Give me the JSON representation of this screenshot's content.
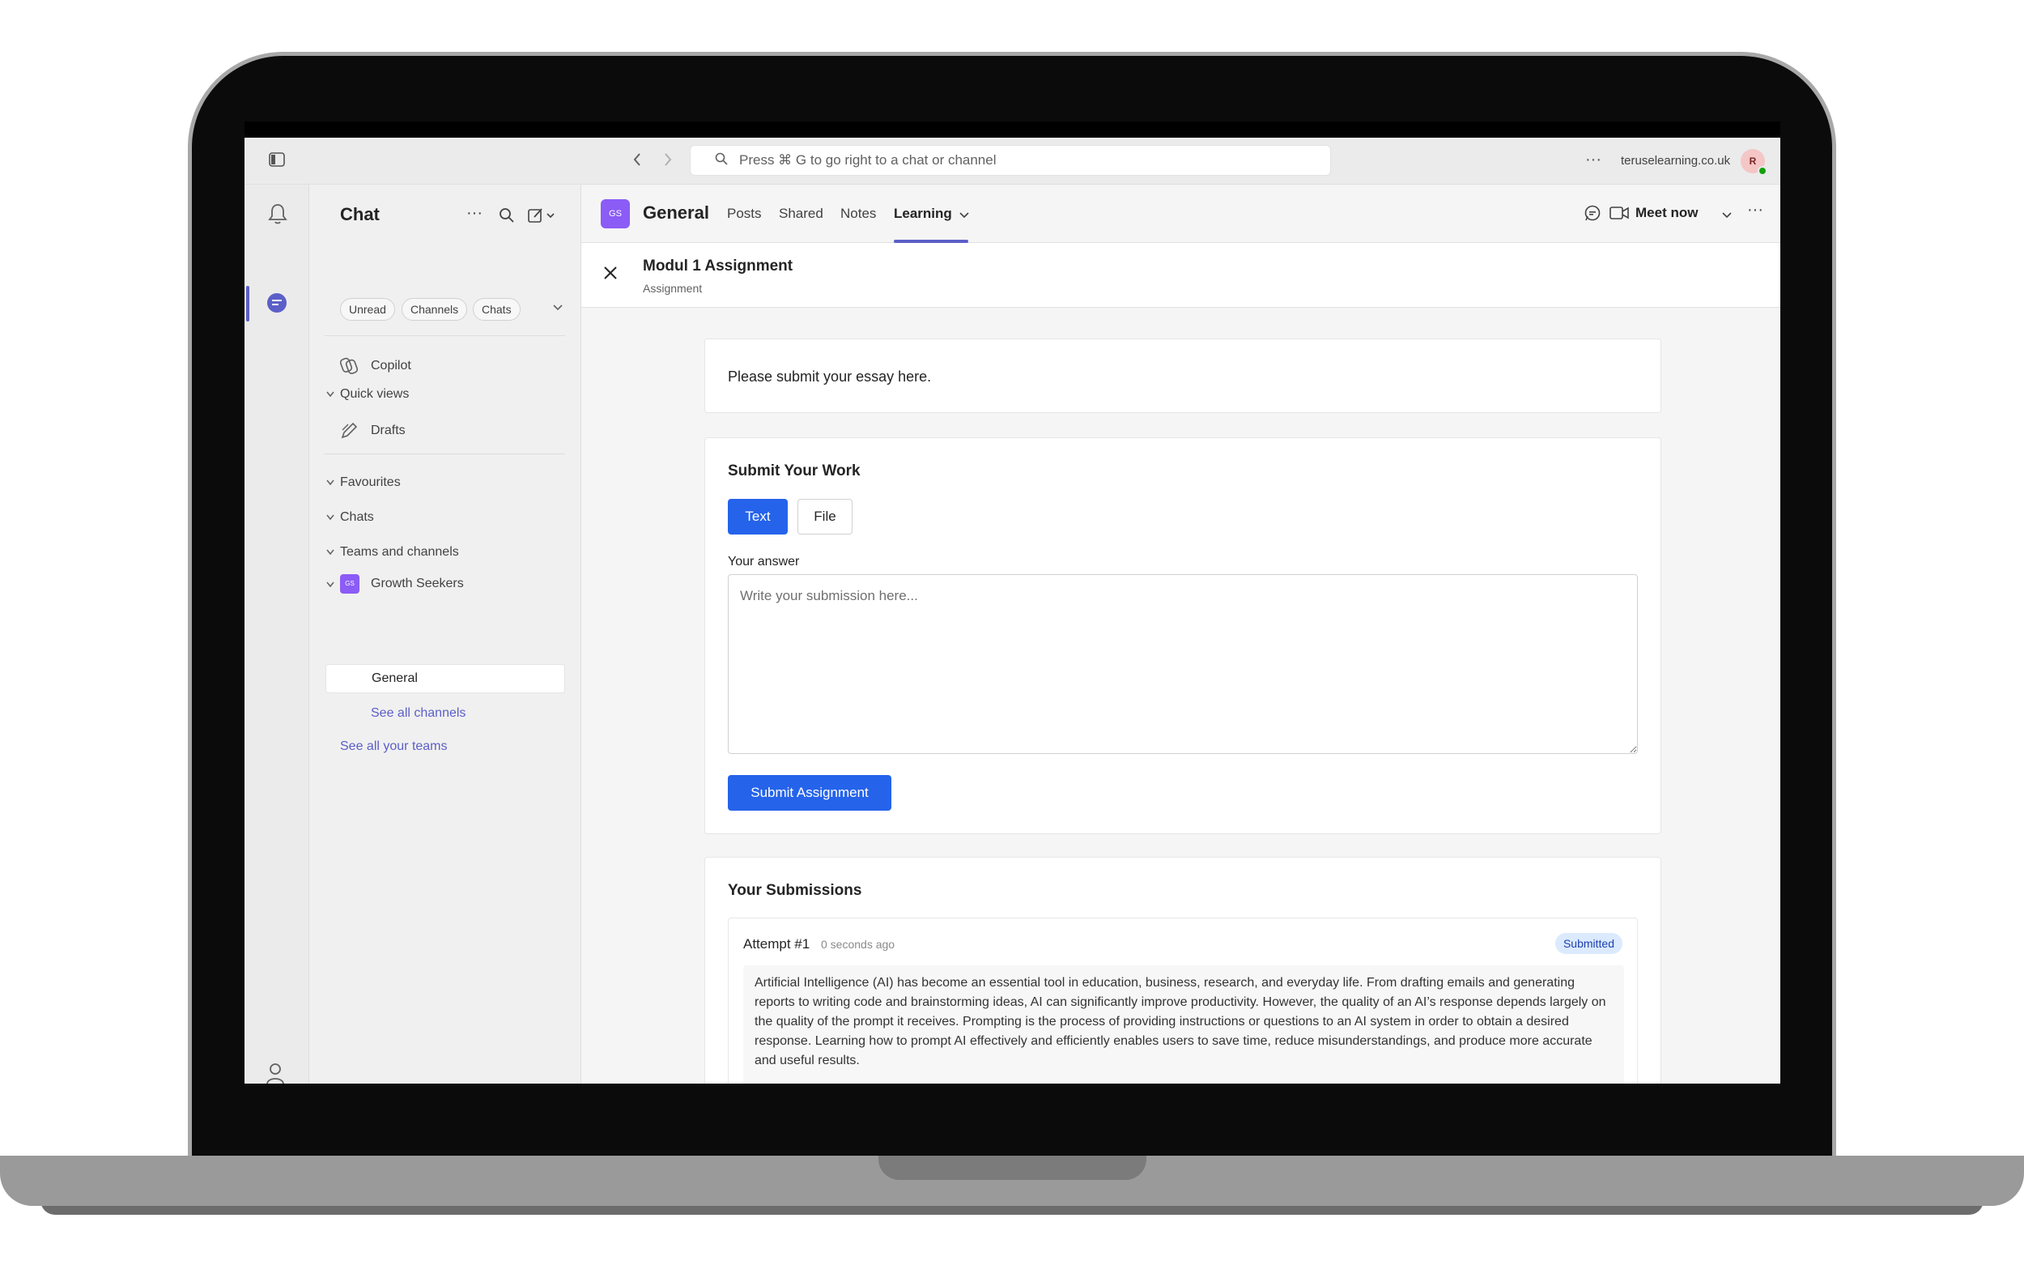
{
  "titlebar": {
    "search_placeholder": "Press ⌘ G to go right to a chat or channel",
    "tenant": "teruselearning.co.uk",
    "avatar_initial": "R"
  },
  "sidebar": {
    "title": "Chat",
    "filters": [
      "Unread",
      "Channels",
      "Chats"
    ],
    "copilot": "Copilot",
    "quick_views": "Quick views",
    "drafts": "Drafts",
    "favourites": "Favourites",
    "chats": "Chats",
    "teams_and_channels": "Teams and channels",
    "team_name": "Growth Seekers",
    "team_initials": "GS",
    "channel_general": "General",
    "see_all_channels": "See all channels",
    "see_all_teams": "See all your teams"
  },
  "channel": {
    "initials": "GS",
    "name": "General",
    "tabs": [
      "Posts",
      "Shared",
      "Notes",
      "Learning"
    ],
    "meet_now": "Meet now"
  },
  "assignment": {
    "title": "Modul 1 Assignment",
    "subtitle": "Assignment",
    "instructions": "Please submit your essay here.",
    "submit_heading": "Submit Your Work",
    "mode_text": "Text",
    "mode_file": "File",
    "answer_label": "Your answer",
    "answer_placeholder": "Write your submission here...",
    "submit_button": "Submit Assignment",
    "submissions_heading": "Your Submissions",
    "attempt_label": "Attempt #1",
    "attempt_time": "0 seconds ago",
    "attempt_status": "Submitted",
    "attempt_body": "Artificial Intelligence (AI) has become an essential tool in education, business, research, and everyday life. From drafting emails and generating reports to writing code and brainstorming ideas, AI can significantly improve productivity. However, the quality of an AI’s response depends largely on the quality of the prompt it receives. Prompting is the process of providing instructions or questions to an AI system in order to obtain a desired response. Learning how to prompt AI effectively and efficiently enables users to save time, reduce misunderstandings, and produce more accurate and useful results."
  },
  "colors": {
    "accent": "#5b5fc7",
    "primary_button": "#2563eb",
    "team_badge": "#8b5cf6",
    "presence": "#13a10e"
  }
}
